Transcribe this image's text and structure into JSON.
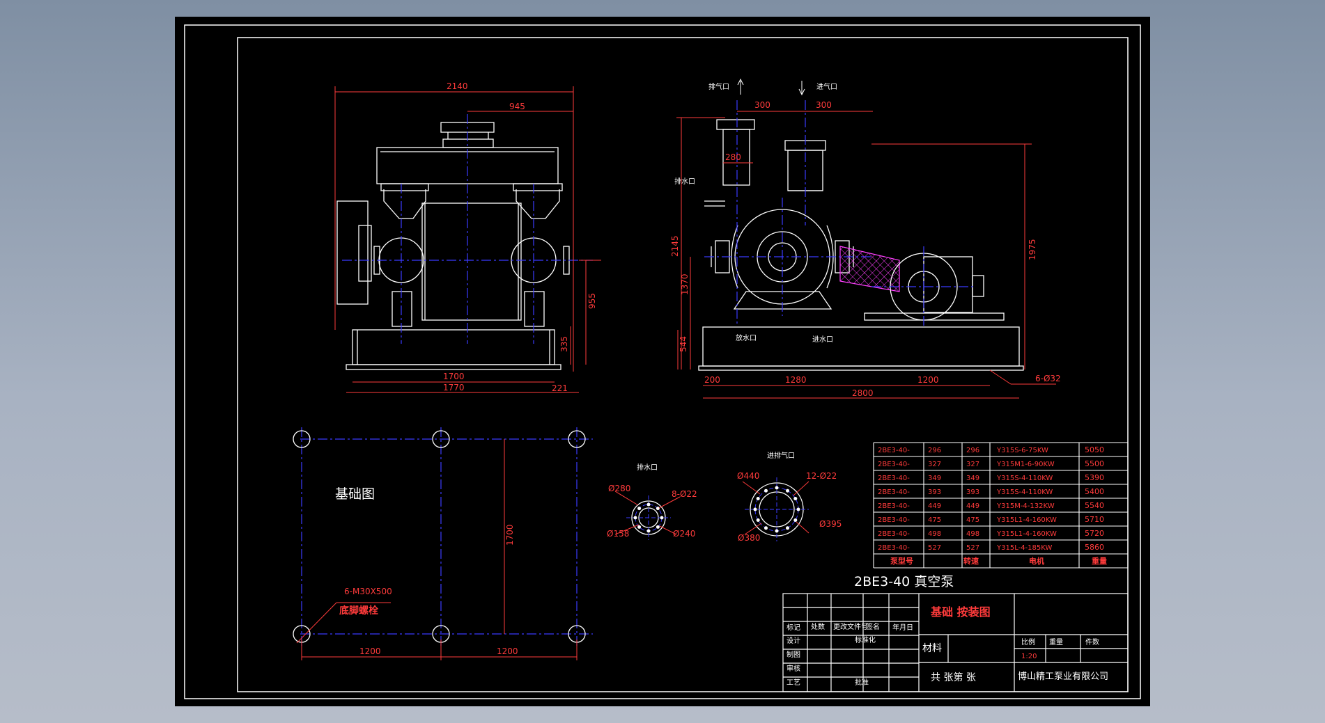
{
  "drawing": {
    "main_title": "2BE3-40 真空泵",
    "foundation_title": "基础图",
    "anchor_bolt_spec": "6-M30X500",
    "anchor_bolt_label": "底脚螺栓",
    "drain_flange_title": "排水口",
    "inout_flange_title": "进排气口",
    "side_labels": {
      "exhaust": "排气口",
      "intake": "进气口",
      "drain": "排水口",
      "discharge": "放水口",
      "inlet_water": "进水口"
    },
    "dims": {
      "front_2140": "2140",
      "front_945": "945",
      "front_1700": "1700",
      "front_1770": "1770",
      "front_221": "221",
      "front_955": "955",
      "front_335": "335",
      "side_300a": "300",
      "side_300b": "300",
      "side_280": "280",
      "side_2145": "2145",
      "side_1370": "1370",
      "side_544": "544",
      "side_1975": "1975",
      "side_200": "200",
      "side_1280": "1280",
      "side_1200": "1200",
      "side_2800": "2800",
      "side_holes": "6-Ø32",
      "found_1700": "1700",
      "found_1200a": "1200",
      "found_1200b": "1200",
      "drain_d280": "Ø280",
      "drain_holes": "8-Ø22",
      "drain_d158": "Ø158",
      "drain_d240": "Ø240",
      "io_d440": "Ø440",
      "io_holes": "12-Ø22",
      "io_d395": "Ø395",
      "io_d380": "Ø380"
    }
  },
  "spec_table": {
    "rows": [
      {
        "model": "2BE3-40-",
        "speed1": "296",
        "speed2": "296",
        "motor": "Y315S-6-75KW",
        "weight": "5050"
      },
      {
        "model": "2BE3-40-",
        "speed1": "327",
        "speed2": "327",
        "motor": "Y315M1-6-90KW",
        "weight": "5500"
      },
      {
        "model": "2BE3-40-",
        "speed1": "349",
        "speed2": "349",
        "motor": "Y315S-4-110KW",
        "weight": "5390"
      },
      {
        "model": "2BE3-40-",
        "speed1": "393",
        "speed2": "393",
        "motor": "Y315S-4-110KW",
        "weight": "5400"
      },
      {
        "model": "2BE3-40-",
        "speed1": "449",
        "speed2": "449",
        "motor": "Y315M-4-132KW",
        "weight": "5540"
      },
      {
        "model": "2BE3-40-",
        "speed1": "475",
        "speed2": "475",
        "motor": "Y315L1-4-160KW",
        "weight": "5710"
      },
      {
        "model": "2BE3-40-",
        "speed1": "498",
        "speed2": "498",
        "motor": "Y315L1-4-160KW",
        "weight": "5720"
      },
      {
        "model": "2BE3-40-",
        "speed1": "527",
        "speed2": "527",
        "motor": "Y315L-4-185KW",
        "weight": "5860"
      }
    ],
    "headers": {
      "model": "泵型号",
      "speed": "转速",
      "motor": "电机",
      "weight": "重量"
    }
  },
  "title_block": {
    "drawing_name": "基础 按装图",
    "company": "博山精工泵业有限公司",
    "sheets": "共  张第  张",
    "material": "材料",
    "scale_label": "比例",
    "weight_label": "重量",
    "count_label": "件数",
    "scale_value": "1:20",
    "mark": "标记",
    "qty": "处数",
    "change_doc": "更改文件号",
    "sign": "签名",
    "date": "年月日",
    "design": "设计",
    "standardize": "标准化",
    "drawing": "制图",
    "review": "审核",
    "process": "工艺",
    "approve": "批准"
  },
  "colors": {
    "outline": "#ffffff",
    "center": "#3b3bff",
    "dimension": "#ff3b3b",
    "hatch": "#ff40ff",
    "label": "#ffffff"
  }
}
